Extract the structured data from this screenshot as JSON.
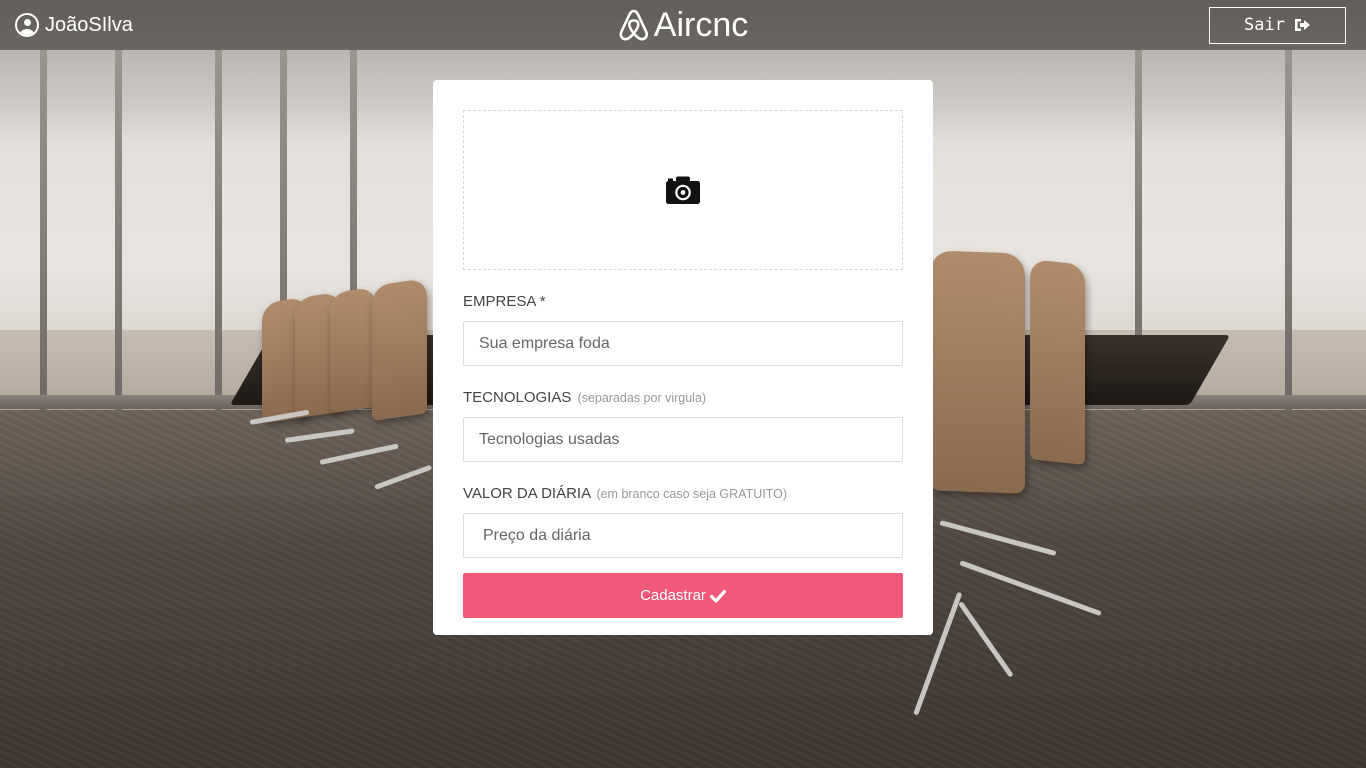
{
  "header": {
    "user_name": "JoãoSIlva",
    "brand_name": "Aircnc",
    "logout_label": "Sair",
    "icons": {
      "user": "user-circle-icon",
      "brand": "airbnb-logo-icon",
      "logout": "sign-out-icon"
    }
  },
  "form": {
    "thumbnail_icon": "camera-icon",
    "company": {
      "label": "EMPRESA *",
      "placeholder": "Sua empresa foda",
      "value": ""
    },
    "techs": {
      "label": "TECNOLOGIAS",
      "hint": "(separadas por virgula)",
      "placeholder": "Tecnologias usadas",
      "value": ""
    },
    "price": {
      "label": "VALOR DA DIÁRIA",
      "hint": "(em branco caso seja GRATUITO)",
      "placeholder": "Preço da diária",
      "value": ""
    },
    "submit_label": "Cadastrar",
    "submit_icon": "check-icon"
  },
  "colors": {
    "accent": "#f05a78",
    "header_bg": "rgba(40,36,33,0.55)",
    "card_bg": "#ffffff",
    "label_text": "#444444",
    "hint_text": "#999999"
  }
}
